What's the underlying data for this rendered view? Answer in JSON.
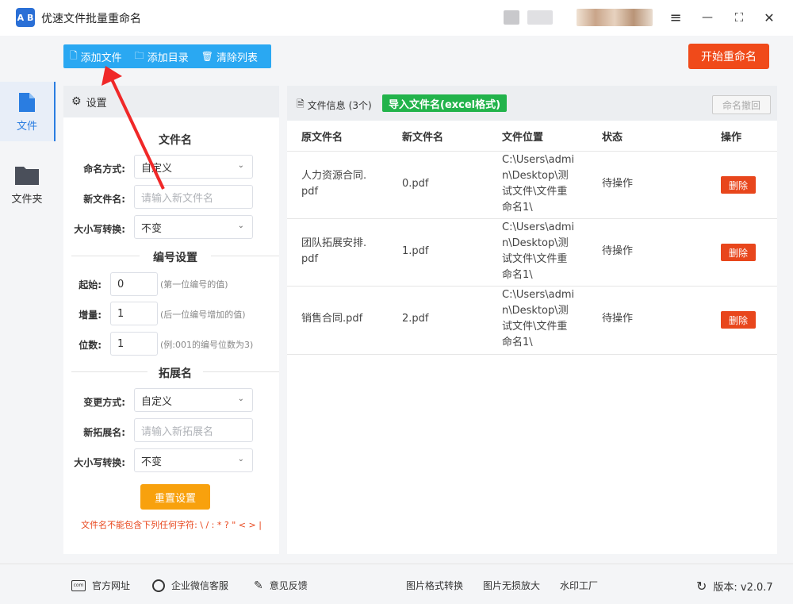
{
  "app": {
    "title": "优速文件批量重命名",
    "logo_text": "A B"
  },
  "window_controls": {
    "menu": "≡",
    "minimize": "—",
    "maximize": "⛶",
    "close": "✕"
  },
  "nav": [
    {
      "label": "文件",
      "icon": "file-icon"
    },
    {
      "label": "文件夹",
      "icon": "folder-icon"
    }
  ],
  "toolbar": {
    "add_file": "添加文件",
    "add_dir": "添加目录",
    "clear_list": "清除列表",
    "start": "开始重命名"
  },
  "settings": {
    "header": "设置",
    "filename_section": "文件名",
    "naming_mode_label": "命名方式:",
    "naming_mode_value": "自定义",
    "new_name_label": "新文件名:",
    "new_name_placeholder": "请输入新文件名",
    "case_label": "大小写转换:",
    "case_value": "不变",
    "numbering_section": "编号设置",
    "start_label": "起始:",
    "start_value": "0",
    "start_hint": "(第一位编号的值)",
    "step_label": "增量:",
    "step_value": "1",
    "step_hint": "(后一位编号增加的值)",
    "digits_label": "位数:",
    "digits_value": "1",
    "digits_hint": "(例:001的编号位数为3)",
    "ext_section": "拓展名",
    "ext_mode_label": "变更方式:",
    "ext_mode_value": "自定义",
    "new_ext_label": "新拓展名:",
    "new_ext_placeholder": "请输入新拓展名",
    "ext_case_label": "大小写转换:",
    "ext_case_value": "不变",
    "reset": "重置设置",
    "warning": "文件名不能包含下列任何字符: \\ / : * ? \" < > |"
  },
  "files": {
    "title": "文件信息",
    "count": "(3个)",
    "import_btn": "导入文件名(excel格式)",
    "undo_btn": "命名撤回",
    "columns": [
      "原文件名",
      "新文件名",
      "文件位置",
      "状态",
      "操作"
    ],
    "rows": [
      {
        "orig": "人力资源合同.pdf",
        "orig_l1": "人力资源合同.",
        "orig_l2": "pdf",
        "new": "0.pdf",
        "loc_l1": "C:\\Users\\admi",
        "loc_l2": "n\\Desktop\\测",
        "loc_l3": "试文件\\文件重",
        "loc_l4": "命名1\\",
        "status": "待操作",
        "action": "删除"
      },
      {
        "orig": "团队拓展安排.pdf",
        "orig_l1": "团队拓展安排.",
        "orig_l2": "pdf",
        "new": "1.pdf",
        "loc_l1": "C:\\Users\\admi",
        "loc_l2": "n\\Desktop\\测",
        "loc_l3": "试文件\\文件重",
        "loc_l4": "命名1\\",
        "status": "待操作",
        "action": "删除"
      },
      {
        "orig": "销售合同.pdf",
        "orig_l1": "销售合同.pdf",
        "orig_l2": "",
        "new": "2.pdf",
        "loc_l1": "C:\\Users\\admi",
        "loc_l2": "n\\Desktop\\测",
        "loc_l3": "试文件\\文件重",
        "loc_l4": "命名1\\",
        "status": "待操作",
        "action": "删除"
      }
    ]
  },
  "footer": {
    "website": "官方网址",
    "wechat": "企业微信客服",
    "feedback": "意见反馈",
    "img_convert": "图片格式转换",
    "img_enlarge": "图片无损放大",
    "watermark": "水印工厂",
    "version": "版本: v2.0.7"
  },
  "colors": {
    "accent_blue": "#2aa8f2",
    "start_red": "#f04a1a",
    "import_green": "#22b34b",
    "reset_orange": "#f8a10d",
    "delete_red": "#e8461c"
  }
}
